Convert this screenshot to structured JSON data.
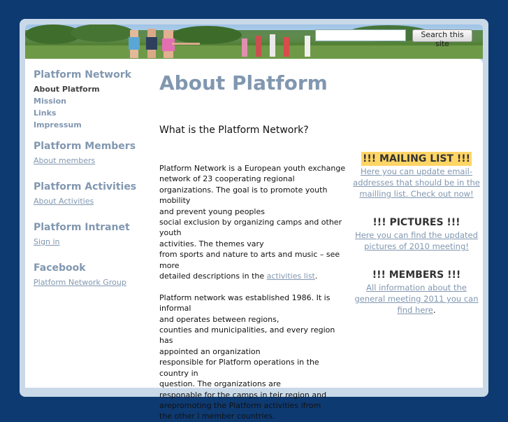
{
  "header": {
    "search_placeholder": "",
    "search_button": "Search this site"
  },
  "sidebar": {
    "sections": [
      {
        "heading": "Platform Network",
        "items": [
          "About Platform",
          "Mission",
          "Links",
          "Impressum"
        ]
      },
      {
        "heading": "Platform Members",
        "items": [
          "About members"
        ]
      },
      {
        "heading": "Platform Activities",
        "items": [
          "About Activities"
        ]
      },
      {
        "heading": "Platform Intranet",
        "items": [
          "Sign in"
        ]
      },
      {
        "heading": "Facebook",
        "items": [
          "Platform Network Group"
        ]
      }
    ]
  },
  "main": {
    "title": "About Platform",
    "subtitle": "What is the Platform Network?",
    "p1_lines": [
      "Platform Network is a European youth exchange",
      "network of 23 cooperating regional",
      "organizations. The goal is to promote youth mobility",
      "and prevent young peoples",
      "social exclusion by organizing camps and other youth",
      "activities. The themes vary",
      "from sports and nature to arts and music – see more"
    ],
    "p1_last_prefix": "detailed descriptions in the ",
    "p1_link": "activities list",
    "p1_suffix": ".",
    "p2_lines": [
      "Platform network was established 1986. It is informal",
      "and operates between regions,",
      "counties and municipalities, and every region has",
      "appointed an organization",
      "responsible for Platform operations in the country in",
      "question. The organizations are",
      "responable for the camps in teir region and",
      "arepromoting the Platform activities ifrom",
      "the other l member countries."
    ]
  },
  "right": {
    "mailing_heading": "!!! MAILING LIST !!!",
    "mailing_link": "Here you can update email-addresses that should be in the mailling list. Check out now!",
    "pictures_heading": "!!! PICTURES !!!",
    "pictures_link": "Here you can find the updated pictures of 2010 meeting!",
    "members_heading": "!!! MEMBERS !!!",
    "members_link": "All information about the general meeting 2011 you can find here",
    "members_suffix": "."
  },
  "colors": {
    "background": "#0e3a72",
    "accent": "#8197b0",
    "highlight": "#ffd566"
  }
}
